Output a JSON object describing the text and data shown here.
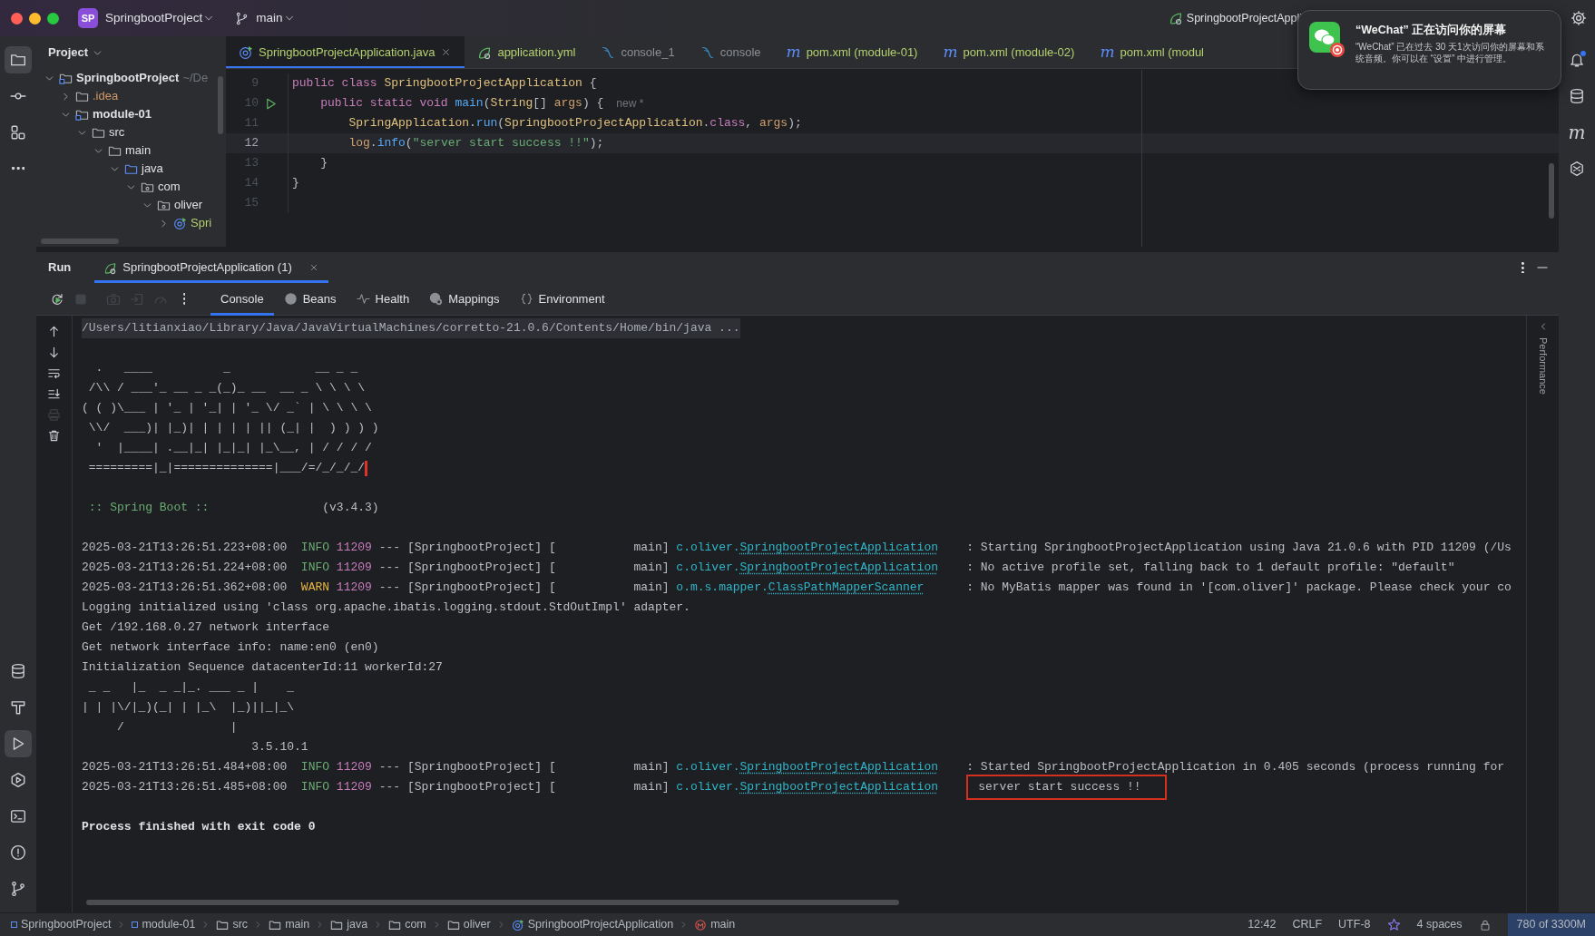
{
  "title_bar": {
    "project_badge": "SP",
    "project": "SpringbootProject",
    "branch": "main",
    "run_config": "SpringbootProjectAppli"
  },
  "left_stripe": {
    "top": [
      {
        "kind": "project",
        "selected": true
      },
      {
        "kind": "commit",
        "selected": false
      },
      {
        "kind": "structure",
        "selected": false
      },
      {
        "kind": "more",
        "selected": false
      }
    ],
    "bottom": [
      {
        "kind": "database",
        "selected": false
      },
      {
        "kind": "build",
        "selected": false
      },
      {
        "kind": "run",
        "selected": true
      },
      {
        "kind": "services",
        "selected": false
      },
      {
        "kind": "terminal",
        "selected": false
      },
      {
        "kind": "problems",
        "selected": false
      },
      {
        "kind": "git",
        "selected": false
      }
    ]
  },
  "project_panel": {
    "title": "Project",
    "tree": [
      {
        "label": "SpringbootProject",
        "hint": "~/De",
        "kind": "project",
        "color": "#dfe1e5",
        "expanded": true,
        "children": [
          {
            "label": ".idea",
            "kind": "folder",
            "color": "#d39a6a",
            "expanded": false
          },
          {
            "label": "module-01",
            "kind": "module",
            "color": "#dfe1e5",
            "expanded": true,
            "children": [
              {
                "label": "src",
                "kind": "folder",
                "color": "#dfe1e5",
                "expanded": true,
                "children": [
                  {
                    "label": "main",
                    "kind": "folder",
                    "color": "#dfe1e5",
                    "expanded": true,
                    "children": [
                      {
                        "label": "java",
                        "kind": "source-root",
                        "color": "#dfe1e5",
                        "expanded": true,
                        "children": [
                          {
                            "label": "com",
                            "kind": "package",
                            "color": "#dfe1e5",
                            "expanded": true,
                            "children": [
                              {
                                "label": "oliver",
                                "kind": "package",
                                "color": "#dfe1e5",
                                "expanded": true,
                                "children": [
                                  {
                                    "label": "Spri",
                                    "kind": "spring-class",
                                    "color": "#b5d16f",
                                    "expanded": false
                                  }
                                ]
                              }
                            ]
                          }
                        ]
                      }
                    ]
                  }
                ]
              }
            ]
          }
        ]
      }
    ]
  },
  "editor": {
    "tabs": [
      {
        "label": "SpringbootProjectApplication.java",
        "kind": "java",
        "color": "#b5d16f",
        "selected": true
      },
      {
        "label": "application.yml",
        "kind": "yaml",
        "color": "#b5d16f",
        "selected": false
      },
      {
        "label": "console_1",
        "kind": "console",
        "color": "#8c8f94",
        "selected": false
      },
      {
        "label": "console",
        "kind": "console",
        "color": "#8c8f94",
        "selected": false
      },
      {
        "label": "pom.xml (module-01)",
        "kind": "maven",
        "glyph": "m",
        "color": "#b5d16f",
        "selected": false
      },
      {
        "label": "pom.xml (module-02)",
        "kind": "maven",
        "glyph": "m",
        "color": "#b5d16f",
        "selected": false
      },
      {
        "label": "pom.xml (modul",
        "kind": "maven",
        "glyph": "m",
        "color": "#b5d16f",
        "selected": false
      }
    ],
    "lines": [
      {
        "number": "9",
        "current": false,
        "runnable": false,
        "tokens": [
          {
            "text": "public class ",
            "kind": "keyword"
          },
          {
            "text": "SpringbootProjectApplication",
            "kind": "type"
          },
          {
            "text": " {",
            "kind": "punct"
          }
        ]
      },
      {
        "number": "10",
        "current": false,
        "runnable": true,
        "hint": "new *",
        "tokens": [
          {
            "text": "    public static void ",
            "kind": "keyword"
          },
          {
            "text": "main",
            "kind": "method"
          },
          {
            "text": "(",
            "kind": "punct"
          },
          {
            "text": "String",
            "kind": "type"
          },
          {
            "text": "[] ",
            "kind": "punct"
          },
          {
            "text": "args",
            "kind": "param"
          },
          {
            "text": ") {",
            "kind": "punct"
          }
        ]
      },
      {
        "number": "11",
        "current": false,
        "runnable": false,
        "tokens": [
          {
            "text": "        SpringApplication",
            "kind": "type"
          },
          {
            "text": ".",
            "kind": "punct"
          },
          {
            "text": "run",
            "kind": "method"
          },
          {
            "text": "(",
            "kind": "punct"
          },
          {
            "text": "SpringbootProjectApplication",
            "kind": "type"
          },
          {
            "text": ".",
            "kind": "punct"
          },
          {
            "text": "class",
            "kind": "keyword"
          },
          {
            "text": ", ",
            "kind": "punct"
          },
          {
            "text": "args",
            "kind": "param"
          },
          {
            "text": ");",
            "kind": "punct"
          }
        ]
      },
      {
        "number": "12",
        "current": true,
        "runnable": false,
        "tokens": [
          {
            "text": "        log",
            "kind": "param"
          },
          {
            "text": ".",
            "kind": "punct"
          },
          {
            "text": "info",
            "kind": "method"
          },
          {
            "text": "(",
            "kind": "punct"
          },
          {
            "text": "\"server start success !!\"",
            "kind": "string"
          },
          {
            "text": ");",
            "kind": "punct"
          }
        ]
      },
      {
        "number": "13",
        "current": false,
        "runnable": false,
        "tokens": [
          {
            "text": "    }",
            "kind": "punct"
          }
        ]
      },
      {
        "number": "14",
        "current": false,
        "runnable": false,
        "tokens": [
          {
            "text": "}",
            "kind": "punct"
          }
        ]
      },
      {
        "number": "15",
        "current": false,
        "runnable": false
      }
    ]
  },
  "run_panel": {
    "title": "Run",
    "tabs": [
      {
        "label": "SpringbootProjectApplication (1)",
        "selected": true
      }
    ],
    "toolbar": [
      {
        "kind": "rerun",
        "disabled": false
      },
      {
        "kind": "stop",
        "disabled": true
      },
      {
        "kind": "camera",
        "disabled": true
      },
      {
        "kind": "exit",
        "disabled": true
      },
      {
        "kind": "gauge",
        "disabled": true
      },
      {
        "kind": "more",
        "disabled": false
      }
    ],
    "tool_tabs": [
      {
        "label": "Console",
        "kind": "none",
        "selected": true
      },
      {
        "label": "Beans",
        "kind": "bean",
        "selected": false
      },
      {
        "label": "Health",
        "kind": "pulse",
        "selected": false
      },
      {
        "label": "Mappings",
        "kind": "mapping",
        "selected": false
      },
      {
        "label": "Environment",
        "kind": "braces",
        "selected": false
      }
    ],
    "side_toolbar": [
      {
        "kind": "arrow-up",
        "disabled": false
      },
      {
        "kind": "arrow-down",
        "disabled": false
      },
      {
        "kind": "wrap",
        "disabled": false
      },
      {
        "kind": "scroll-end",
        "disabled": false
      },
      {
        "kind": "print",
        "disabled": true
      },
      {
        "kind": "trash",
        "disabled": false
      }
    ],
    "console": [
      {
        "kind": "command",
        "text": "/Users/litianxiao/Library/Java/JavaVirtualMachines/corretto-21.0.6/Contents/Home/bin/java ..."
      },
      {
        "kind": "blank"
      },
      {
        "kind": "banner",
        "cursor": false,
        "text": "  .   ____          _            __ _ _"
      },
      {
        "kind": "banner",
        "cursor": false,
        "text": " /\\\\ / ___'_ __ _ _(_)_ __  __ _ \\ \\ \\ \\"
      },
      {
        "kind": "banner",
        "cursor": false,
        "text": "( ( )\\___ | '_ | '_| | '_ \\/ _` | \\ \\ \\ \\"
      },
      {
        "kind": "banner",
        "cursor": false,
        "text": " \\\\/  ___)| |_)| | | | | || (_| |  ) ) ) )"
      },
      {
        "kind": "banner",
        "cursor": false,
        "text": "  '  |____| .__|_| |_|_| |_\\__, | / / / /"
      },
      {
        "kind": "banner",
        "cursor": true,
        "text": " =========|_|==============|___/=/_/_/_/"
      },
      {
        "kind": "blank"
      },
      {
        "kind": "boot",
        "label": ":: Spring Boot ::",
        "version": "(v3.4.3)"
      },
      {
        "kind": "blank"
      },
      {
        "kind": "log",
        "timestamp": "2025-03-21T13:26:51.223+08:00",
        "severity": "INFO",
        "pid": "11209",
        "thread": "--- [SpringbootProject] [           main]",
        "logger_package": "c.oliver.",
        "logger_class": "SpringbootProjectApplication",
        "message": ": Starting SpringbootProjectApplication using Java 21.0.6 with PID 11209 (/Us",
        "boxed": false
      },
      {
        "kind": "log",
        "timestamp": "2025-03-21T13:26:51.224+08:00",
        "severity": "INFO",
        "pid": "11209",
        "thread": "--- [SpringbootProject] [           main]",
        "logger_package": "c.oliver.",
        "logger_class": "SpringbootProjectApplication",
        "message": ": No active profile set, falling back to 1 default profile: \"default\"",
        "boxed": false
      },
      {
        "kind": "log",
        "timestamp": "2025-03-21T13:26:51.362+08:00",
        "severity": "WARN",
        "pid": "11209",
        "thread": "--- [SpringbootProject] [           main]",
        "logger_package": "o.m.s.mapper.",
        "logger_class": "ClassPathMapperScanner",
        "message": ": No MyBatis mapper was found in '[com.oliver]' package. Please check your co",
        "boxed": false
      },
      {
        "kind": "plain",
        "text": "Logging initialized using 'class org.apache.ibatis.logging.stdout.StdOutImpl' adapter."
      },
      {
        "kind": "plain",
        "text": "Get /192.168.0.27 network interface"
      },
      {
        "kind": "plain",
        "text": "Get network interface info: name:en0 (en0)"
      },
      {
        "kind": "plain",
        "text": "Initialization Sequence datacenterId:11 workerId:27"
      },
      {
        "kind": "banner",
        "cursor": false,
        "text": " _ _   |_  _ _|_. ___ _ |    _"
      },
      {
        "kind": "banner",
        "cursor": false,
        "text": "| | |\\/|_)(_| | |_\\  |_)||_|_\\"
      },
      {
        "kind": "banner",
        "cursor": false,
        "text": "     /               |"
      },
      {
        "kind": "banner",
        "cursor": false,
        "text": "                        3.5.10.1"
      },
      {
        "kind": "log",
        "timestamp": "2025-03-21T13:26:51.484+08:00",
        "severity": "INFO",
        "pid": "11209",
        "thread": "--- [SpringbootProject] [           main]",
        "logger_package": "c.oliver.",
        "logger_class": "SpringbootProjectApplication",
        "message": ": Started SpringbootProjectApplication in 0.405 seconds (process running for",
        "boxed": false
      },
      {
        "kind": "log",
        "timestamp": "2025-03-21T13:26:51.485+08:00",
        "severity": "INFO",
        "pid": "11209",
        "thread": "--- [SpringbootProject] [           main]",
        "logger_package": "c.oliver.",
        "logger_class": "SpringbootProjectApplication",
        "message": "server start success !!",
        "boxed": true
      },
      {
        "kind": "blank"
      },
      {
        "kind": "exit",
        "text": "Process finished with exit code 0"
      }
    ],
    "side_label": "Performance"
  },
  "right_stripe": [
    {
      "kind": "bell",
      "unread": true
    },
    {
      "kind": "database",
      "unread": false
    },
    {
      "kind": "maven",
      "glyph": "m",
      "unread": false
    },
    {
      "kind": "ai",
      "unread": false
    }
  ],
  "status_bar": {
    "breadcrumbs": [
      {
        "label": "SpringbootProject",
        "kind": "module"
      },
      {
        "label": "module-01",
        "kind": "module"
      },
      {
        "label": "src",
        "kind": "folder"
      },
      {
        "label": "main",
        "kind": "folder"
      },
      {
        "label": "java",
        "kind": "folder"
      },
      {
        "label": "com",
        "kind": "folder"
      },
      {
        "label": "oliver",
        "kind": "folder"
      },
      {
        "label": "SpringbootProjectApplication",
        "kind": "spring-class"
      },
      {
        "label": "main",
        "kind": "method"
      }
    ],
    "items": [
      {
        "kind": "text",
        "label": "12:42"
      },
      {
        "kind": "text",
        "label": "CRLF"
      },
      {
        "kind": "text",
        "label": "UTF-8"
      },
      {
        "kind": "star"
      },
      {
        "kind": "text",
        "label": "4 spaces"
      },
      {
        "kind": "lock"
      },
      {
        "kind": "memory",
        "label": "780 of 3300M"
      }
    ]
  },
  "notification": {
    "title": "“WeChat” 正在访问你的屏幕",
    "body": "“WeChat” 已在过去 30 天1次访问你的屏幕和系统音频。你可以在 “设置” 中进行管理。"
  }
}
